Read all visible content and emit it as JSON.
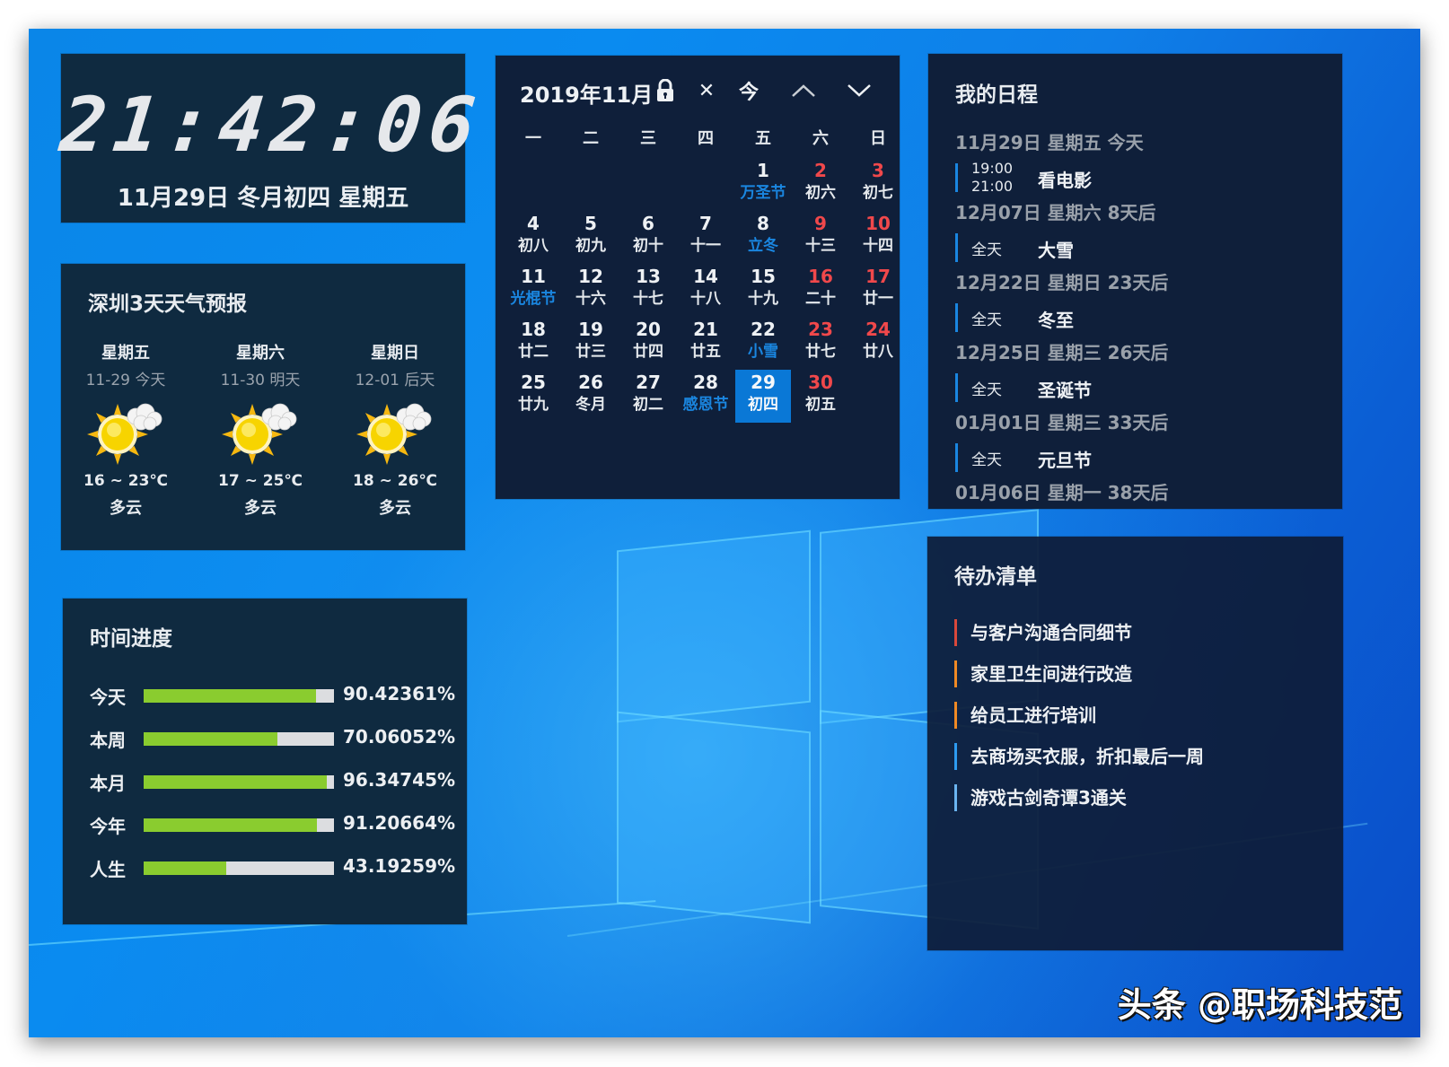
{
  "clock": {
    "time": "21:42:06",
    "date": "11月29日 冬月初四 星期五"
  },
  "weather": {
    "title": "深圳3天天气预报",
    "days": [
      {
        "weekday": "星期五",
        "date": "11-29 今天",
        "icon": "partly-cloudy-icon",
        "temp": "16 ~ 23℃",
        "desc": "多云"
      },
      {
        "weekday": "星期六",
        "date": "11-30 明天",
        "icon": "partly-cloudy-icon",
        "temp": "17 ~ 25℃",
        "desc": "多云"
      },
      {
        "weekday": "星期日",
        "date": "12-01 后天",
        "icon": "partly-cloudy-icon",
        "temp": "18 ~ 26℃",
        "desc": "多云"
      }
    ]
  },
  "progress": {
    "title": "时间进度",
    "rows": [
      {
        "label": "今天",
        "percent": 90.42361,
        "text": "90.42361%"
      },
      {
        "label": "本周",
        "percent": 70.06052,
        "text": "70.06052%"
      },
      {
        "label": "本月",
        "percent": 96.34745,
        "text": "96.34745%"
      },
      {
        "label": "今年",
        "percent": 91.20664,
        "text": "91.20664%"
      },
      {
        "label": "人生",
        "percent": 43.19259,
        "text": "43.19259%"
      }
    ],
    "colors": {
      "fill": "#8acc2f",
      "track": "#dcdde0"
    }
  },
  "calendar": {
    "title": "2019年11月",
    "buttons": {
      "lock": "lock-icon",
      "close": "✕",
      "today": "今",
      "prev": "up-chevron",
      "next": "down-chevron"
    },
    "weekdays": [
      "一",
      "二",
      "三",
      "四",
      "五",
      "六",
      "日"
    ],
    "leading_blanks": 4,
    "days": [
      {
        "n": "1",
        "l": "万圣节",
        "f": true
      },
      {
        "n": "2",
        "l": "初六",
        "w": true
      },
      {
        "n": "3",
        "l": "初七",
        "w": true
      },
      {
        "n": "4",
        "l": "初八"
      },
      {
        "n": "5",
        "l": "初九"
      },
      {
        "n": "6",
        "l": "初十"
      },
      {
        "n": "7",
        "l": "十一"
      },
      {
        "n": "8",
        "l": "立冬",
        "f": true
      },
      {
        "n": "9",
        "l": "十三",
        "w": true
      },
      {
        "n": "10",
        "l": "十四",
        "w": true
      },
      {
        "n": "11",
        "l": "光棍节",
        "f": true
      },
      {
        "n": "12",
        "l": "十六"
      },
      {
        "n": "13",
        "l": "十七"
      },
      {
        "n": "14",
        "l": "十八"
      },
      {
        "n": "15",
        "l": "十九"
      },
      {
        "n": "16",
        "l": "二十",
        "w": true
      },
      {
        "n": "17",
        "l": "廿一",
        "w": true
      },
      {
        "n": "18",
        "l": "廿二"
      },
      {
        "n": "19",
        "l": "廿三"
      },
      {
        "n": "20",
        "l": "廿四"
      },
      {
        "n": "21",
        "l": "廿五"
      },
      {
        "n": "22",
        "l": "小雪",
        "f": true
      },
      {
        "n": "23",
        "l": "廿七",
        "w": true
      },
      {
        "n": "24",
        "l": "廿八",
        "w": true
      },
      {
        "n": "25",
        "l": "廿九"
      },
      {
        "n": "26",
        "l": "冬月"
      },
      {
        "n": "27",
        "l": "初二"
      },
      {
        "n": "28",
        "l": "感恩节",
        "f": true
      },
      {
        "n": "29",
        "l": "初四",
        "today": true
      },
      {
        "n": "30",
        "l": "初五",
        "w": true
      }
    ],
    "colors": {
      "weekend": "#f0484b",
      "festival": "#1a86e0",
      "today_bg": "#0a78d6"
    }
  },
  "schedule": {
    "title": "我的日程",
    "groups": [
      {
        "date": "11月29日 星期五 今天",
        "events": [
          {
            "start": "19:00",
            "end": "21:00",
            "title": "看电影"
          }
        ]
      },
      {
        "date": "12月07日 星期六 8天后",
        "events": [
          {
            "allday": "全天",
            "title": "大雪"
          }
        ]
      },
      {
        "date": "12月22日 星期日 23天后",
        "events": [
          {
            "allday": "全天",
            "title": "冬至"
          }
        ]
      },
      {
        "date": "12月25日 星期三 26天后",
        "events": [
          {
            "allday": "全天",
            "title": "圣诞节"
          }
        ]
      },
      {
        "date": "01月01日 星期三 33天后",
        "events": [
          {
            "allday": "全天",
            "title": "元旦节"
          }
        ]
      },
      {
        "date": "01月06日 星期一 38天后",
        "events": []
      }
    ]
  },
  "todo": {
    "title": "待办清单",
    "items": [
      {
        "text": "与客户沟通合同细节",
        "color": "#d9483b"
      },
      {
        "text": "家里卫生间进行改造",
        "color": "#f08a24"
      },
      {
        "text": "给员工进行培训",
        "color": "#f08a24"
      },
      {
        "text": "去商场买衣服，折扣最后一周",
        "color": "#2d9bf0"
      },
      {
        "text": "游戏古剑奇谭3通关",
        "color": "#6ab4f0"
      }
    ]
  },
  "watermark": "头条 @职场科技范"
}
